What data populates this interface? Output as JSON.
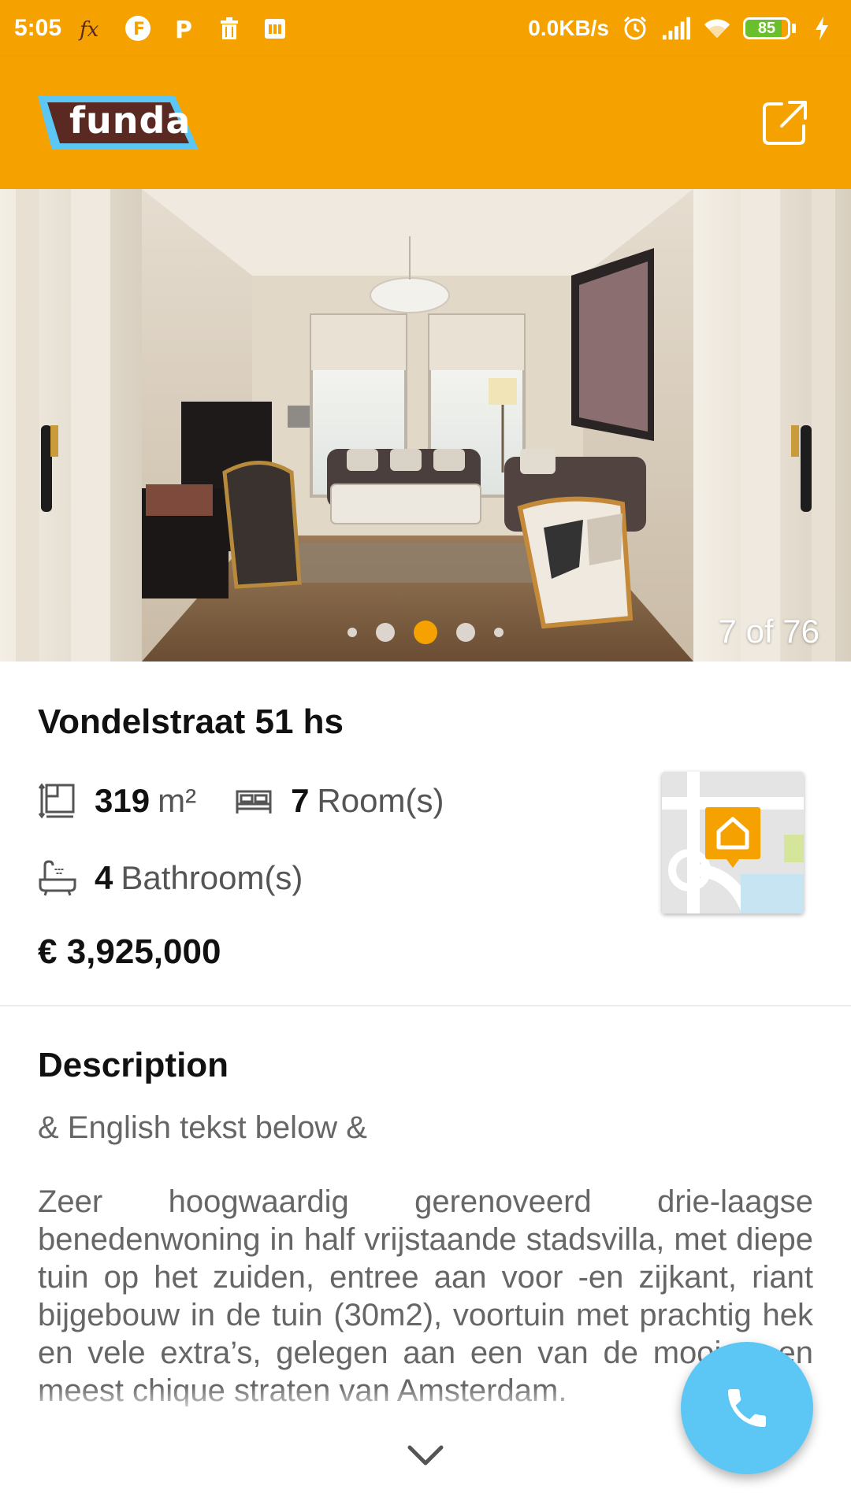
{
  "status_bar": {
    "time": "5:05",
    "net_speed": "0.0KB/s",
    "battery_percent": "85",
    "battery_level": 0.85,
    "icons": [
      "fx-icon",
      "f-badge-icon",
      "p-badge-icon",
      "trash-icon",
      "calendar-icon",
      "alarm-icon",
      "signal-icon",
      "wifi-icon",
      "battery-icon",
      "charging-icon"
    ]
  },
  "app_bar": {
    "logo_text": "funda",
    "share_icon": "open-external-icon"
  },
  "gallery": {
    "counter": "7 of 76",
    "current_index": 7,
    "total": 76,
    "dots": 5,
    "active_dot": 2
  },
  "listing": {
    "address": "Vondelstraat 51 hs",
    "area_value": "319",
    "area_unit": "m²",
    "rooms_value": "7",
    "rooms_label": "Room(s)",
    "bathrooms_value": "4",
    "bathrooms_label": "Bathroom(s)",
    "price": "€ 3,925,000"
  },
  "description": {
    "title": "Description",
    "subtitle": "& English tekst below &",
    "body": "Zeer hoogwaardig gerenoveerd drie-laagse benedenwoning in half vrijstaande stadsvilla, met diepe tuin op het zuiden, entree aan voor -en zijkant, riant bijgebouw in de tuin (30m2), voortuin met prachtig hek en vele extra’s, gelegen aan een van de mooiste en meest chique straten van Amsterdam."
  },
  "colors": {
    "brand_orange": "#f5a200",
    "fab_blue": "#5cc6f5",
    "logo_brown": "#5a2a22",
    "logo_blue": "#5cc6f5"
  }
}
